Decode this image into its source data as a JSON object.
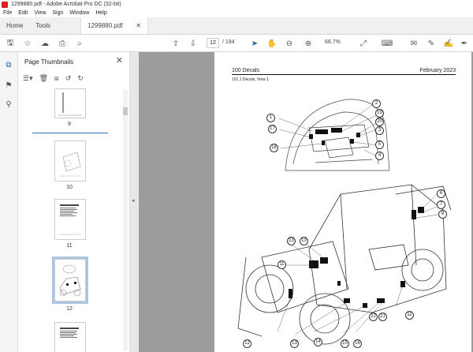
{
  "window": {
    "title": "1299880.pdf - Adobe Acrobat Pro DC (32-bit)"
  },
  "menu": [
    "File",
    "Edit",
    "View",
    "Sign",
    "Window",
    "Help"
  ],
  "tabs": {
    "home": "Home",
    "tools": "Tools",
    "document": "1299880.pdf"
  },
  "toolbar": {
    "current_page": "12",
    "page_of": "/ 194",
    "zoom": "66.7%"
  },
  "panel": {
    "title": "Page Thumbnails",
    "thumbnails": [
      {
        "label": "9"
      },
      {
        "label": "10"
      },
      {
        "label": "11"
      },
      {
        "label": "12",
        "selected": true
      }
    ]
  },
  "document": {
    "header_left": "100 Decals",
    "header_right": "February 2023",
    "subheading": "101.1 Decals, View 1",
    "callouts": [
      "1",
      "2",
      "19",
      "20",
      "17",
      "3",
      "5",
      "18",
      "4",
      "6",
      "7",
      "8",
      "23",
      "10",
      "11",
      "12",
      "13",
      "14",
      "15",
      "16",
      "22",
      "21",
      "11"
    ]
  }
}
